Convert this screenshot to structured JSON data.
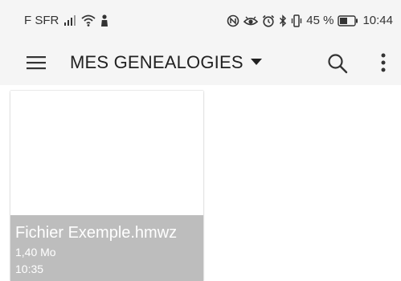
{
  "status_bar": {
    "carrier": "F SFR",
    "battery_percent": "45 %",
    "time": "10:44",
    "icons": [
      "signal-icon",
      "wifi-icon",
      "person-icon",
      "nfc-icon",
      "eye-icon",
      "alarm-icon",
      "bluetooth-icon",
      "vibrate-icon",
      "battery-icon"
    ]
  },
  "app_bar": {
    "title": "MES GENEALOGIES",
    "menu_icon": "hamburger-menu-icon",
    "dropdown_icon": "dropdown-arrow-icon",
    "search_icon": "search-icon",
    "more_icon": "more-vertical-icon"
  },
  "files": [
    {
      "name": "Fichier Exemple.hmwz",
      "size": "1,40 Mo",
      "time": "10:35"
    }
  ],
  "colors": {
    "bar_background": "#f5f5f5",
    "card_footer": "#bdbdbd",
    "card_text": "#ffffff",
    "title_text": "#212121"
  }
}
